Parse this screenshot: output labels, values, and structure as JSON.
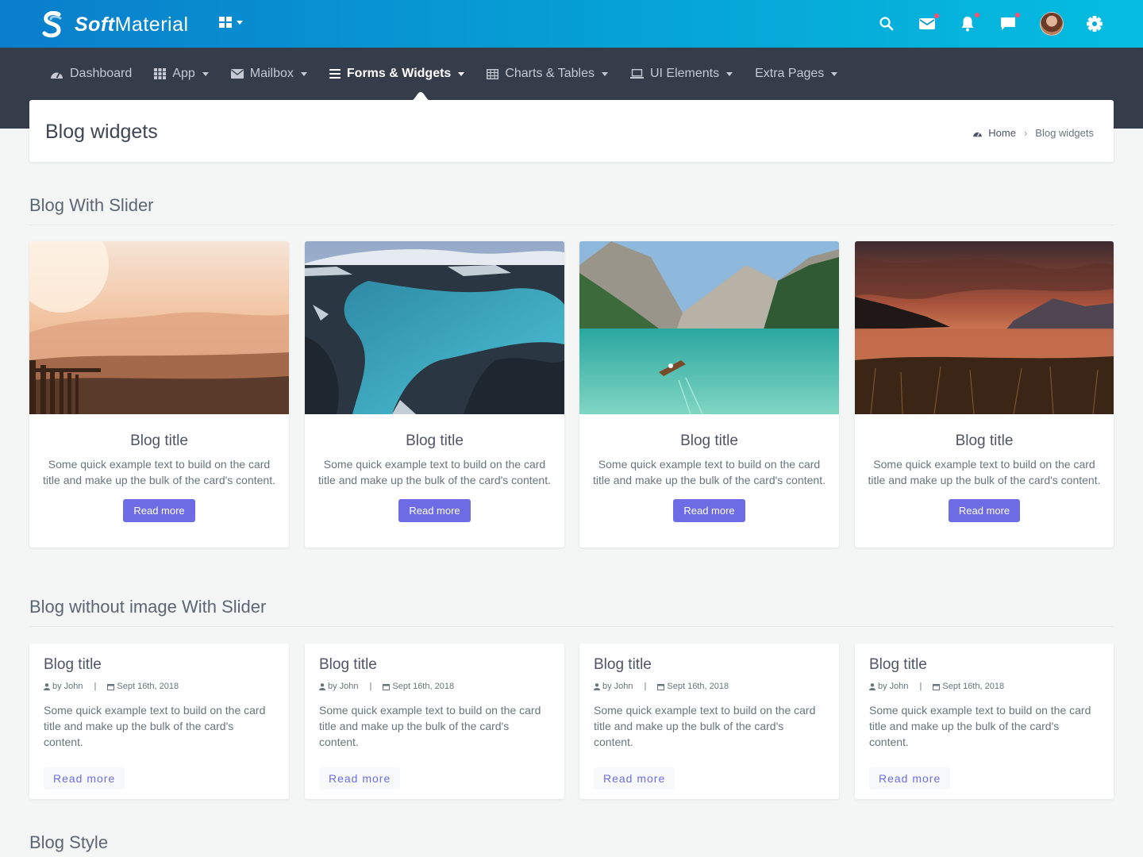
{
  "header": {
    "logo_bold": "Soft",
    "logo_light": "Material",
    "icons": [
      "search-icon",
      "mail-icon",
      "bell-icon",
      "chat-icon",
      "avatar",
      "gear-icon"
    ],
    "notification_dot_color": "#ff4f70"
  },
  "nav": {
    "items": [
      {
        "label": "Dashboard",
        "icon": "dashboard-icon",
        "dropdown": false
      },
      {
        "label": "App",
        "icon": "grid-icon",
        "dropdown": true
      },
      {
        "label": "Mailbox",
        "icon": "envelope-icon",
        "dropdown": true
      },
      {
        "label": "Forms & Widgets",
        "icon": "list-icon",
        "dropdown": true,
        "active": true
      },
      {
        "label": "Charts & Tables",
        "icon": "table-icon",
        "dropdown": true
      },
      {
        "label": "UI Elements",
        "icon": "laptop-icon",
        "dropdown": true
      },
      {
        "label": "Extra Pages",
        "icon": "",
        "dropdown": true
      }
    ]
  },
  "page": {
    "title": "Blog widgets",
    "breadcrumb": {
      "home": "Home",
      "current": "Blog widgets"
    }
  },
  "sections": {
    "slider": "Blog With Slider",
    "no_image": "Blog without image With Slider",
    "style": "Blog Style"
  },
  "image_cards": [
    {
      "title": "Blog title",
      "text": "Some quick example text to build on the card title and make up the bulk of the card's content.",
      "button": "Read more",
      "image": "sunset-meadow"
    },
    {
      "title": "Blog title",
      "text": "Some quick example text to build on the card title and make up the bulk of the card's content.",
      "button": "Read more",
      "image": "glacier-river"
    },
    {
      "title": "Blog title",
      "text": "Some quick example text to build on the card title and make up the bulk of the card's content.",
      "button": "Read more",
      "image": "mountain-lake-boat"
    },
    {
      "title": "Blog title",
      "text": "Some quick example text to build on the card title and make up the bulk of the card's content.",
      "button": "Read more",
      "image": "sunset-lake"
    }
  ],
  "text_cards": [
    {
      "title": "Blog title",
      "author": "by John",
      "date": "Sept 16th, 2018",
      "text": "Some quick example text to build on the card title and make up the bulk of the card's content.",
      "button": "Read more"
    },
    {
      "title": "Blog title",
      "author": "by John",
      "date": "Sept 16th, 2018",
      "text": "Some quick example text to build on the card title and make up the bulk of the card's content.",
      "button": "Read more"
    },
    {
      "title": "Blog title",
      "author": "by John",
      "date": "Sept 16th, 2018",
      "text": "Some quick example text to build on the card title and make up the bulk of the card's content.",
      "button": "Read more"
    },
    {
      "title": "Blog title",
      "author": "by John",
      "date": "Sept 16th, 2018",
      "text": "Some quick example text to build on the card title and make up the bulk of the card's content.",
      "button": "Read more"
    }
  ],
  "colors": {
    "primary": "#6d6ce4",
    "nav_bg": "#363d4a",
    "header_gradient_start": "#0a7ecb",
    "header_gradient_end": "#05bde0"
  }
}
